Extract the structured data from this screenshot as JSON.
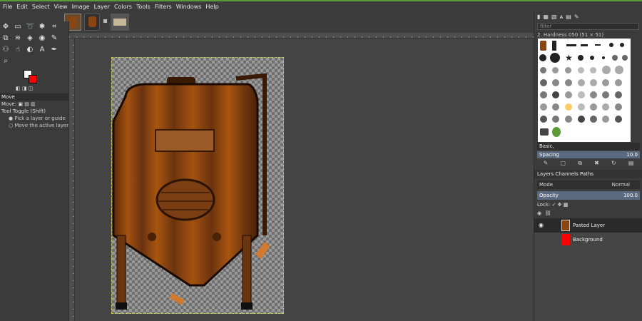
{
  "menu": [
    "File",
    "Edit",
    "Select",
    "View",
    "Image",
    "Layer",
    "Colors",
    "Tools",
    "Filters",
    "Windows",
    "Help"
  ],
  "tool_options": {
    "title": "Move",
    "move_label": "Move:",
    "toggle_label": "Tool Toggle  (Shift)",
    "option1": "Pick a layer or guide",
    "option2": "Move the active layer"
  },
  "brushes": {
    "filter_placeholder": "filter",
    "current_brush": "2. Hardness 050 (51 × 51)",
    "preset": "Basic,",
    "spacing_label": "Spacing",
    "spacing_value": "10.0"
  },
  "layers_panel": {
    "tabs": "Layers  Channels  Paths",
    "mode_label": "Mode",
    "mode_value": "Normal",
    "opacity_label": "Opacity",
    "opacity_value": "100.0",
    "lock_label": "Lock:",
    "layers": [
      {
        "name": "Pasted Layer",
        "visible": true,
        "thumb_color": "#8b4513"
      },
      {
        "name": "Background",
        "visible": false,
        "thumb_color": "#ff0000"
      }
    ]
  },
  "colors": {
    "foreground": "#ffffff",
    "background": "#ff0000",
    "selection_border": "#c9c94a",
    "tank_brown": "#8b4513"
  }
}
